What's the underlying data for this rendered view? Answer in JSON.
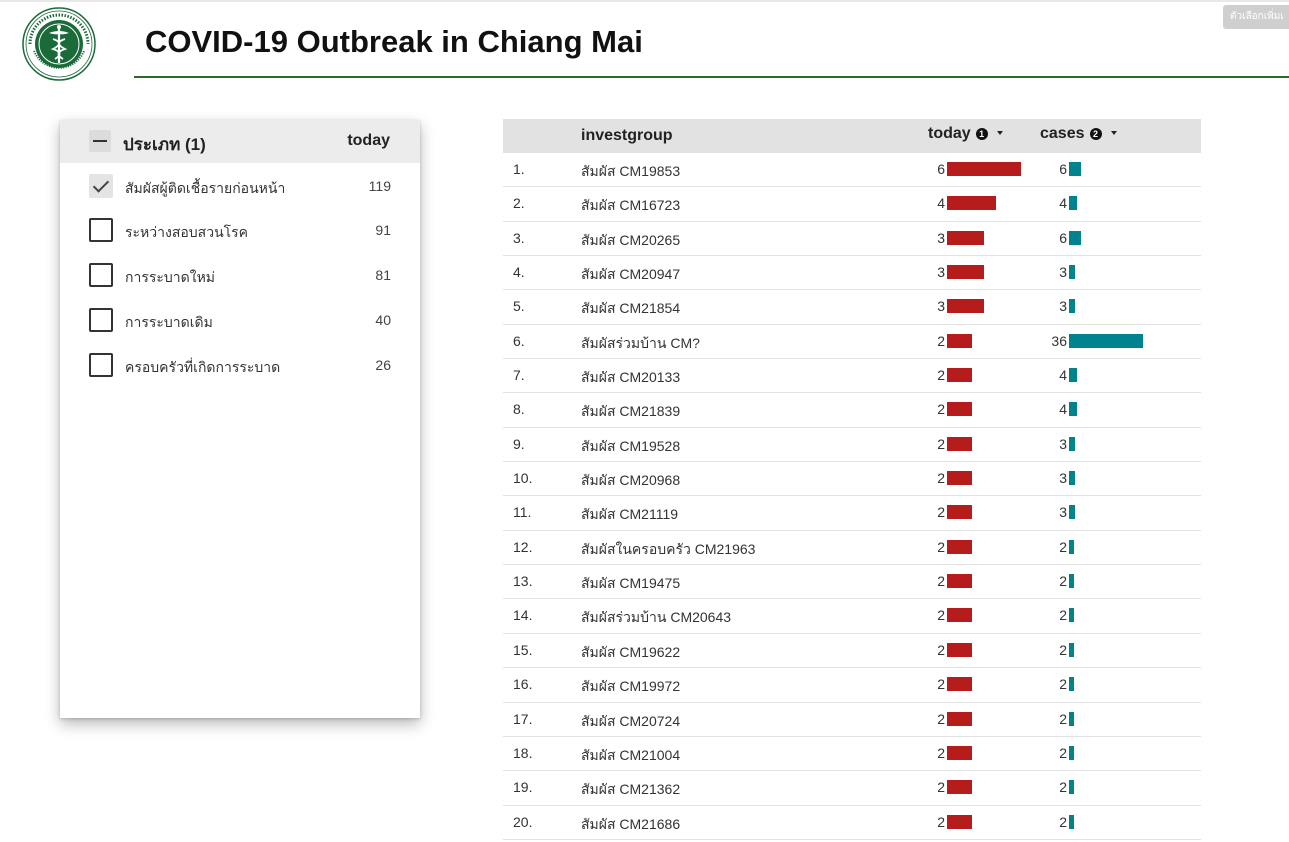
{
  "header": {
    "title": "COVID-19 Outbreak in Chiang Mai",
    "more_selectors_label": "ตัวเลือกเพิ่มเ"
  },
  "logo": {
    "icon": "caduceus-seal-icon",
    "color": "#1b6b3a"
  },
  "filter": {
    "title": "ประเภท (1)",
    "metric_label": "today",
    "items": [
      {
        "label": "สัมผัสผู้ติดเชื้อรายก่อนหน้า",
        "count": "119",
        "checked": true
      },
      {
        "label": "ระหว่างสอบสวนโรค",
        "count": "91",
        "checked": false
      },
      {
        "label": "การระบาดใหม่",
        "count": "81",
        "checked": false
      },
      {
        "label": "การระบาดเดิม",
        "count": "40",
        "checked": false
      },
      {
        "label": "ครอบครัวที่เกิดการระบาด",
        "count": "26",
        "checked": false
      }
    ]
  },
  "table": {
    "columns": {
      "group": "investgroup",
      "today": "today",
      "today_badge": "1",
      "cases": "cases",
      "cases_badge": "2"
    },
    "colors": {
      "today_bar": "#b71c1c",
      "cases_bar": "#00838f"
    },
    "rows": [
      {
        "index": "1.",
        "group": "สัมผัส CM19853",
        "today": 6,
        "cases": 6
      },
      {
        "index": "2.",
        "group": "สัมผัส CM16723",
        "today": 4,
        "cases": 4
      },
      {
        "index": "3.",
        "group": "สัมผัส CM20265",
        "today": 3,
        "cases": 6
      },
      {
        "index": "4.",
        "group": "สัมผัส CM20947",
        "today": 3,
        "cases": 3
      },
      {
        "index": "5.",
        "group": "สัมผัส CM21854",
        "today": 3,
        "cases": 3
      },
      {
        "index": "6.",
        "group": "สัมผัสร่วมบ้าน CM?",
        "today": 2,
        "cases": 36
      },
      {
        "index": "7.",
        "group": "สัมผัส CM20133",
        "today": 2,
        "cases": 4
      },
      {
        "index": "8.",
        "group": "สัมผัส CM21839",
        "today": 2,
        "cases": 4
      },
      {
        "index": "9.",
        "group": "สัมผัส CM19528",
        "today": 2,
        "cases": 3
      },
      {
        "index": "10.",
        "group": "สัมผัส CM20968",
        "today": 2,
        "cases": 3
      },
      {
        "index": "11.",
        "group": "สัมผัส CM21119",
        "today": 2,
        "cases": 3
      },
      {
        "index": "12.",
        "group": "สัมผัสในครอบครัว CM21963",
        "today": 2,
        "cases": 2
      },
      {
        "index": "13.",
        "group": "สัมผัส CM19475",
        "today": 2,
        "cases": 2
      },
      {
        "index": "14.",
        "group": "สัมผัสร่วมบ้าน CM20643",
        "today": 2,
        "cases": 2
      },
      {
        "index": "15.",
        "group": "สัมผัส CM19622",
        "today": 2,
        "cases": 2
      },
      {
        "index": "16.",
        "group": "สัมผัส CM19972",
        "today": 2,
        "cases": 2
      },
      {
        "index": "17.",
        "group": "สัมผัส CM20724",
        "today": 2,
        "cases": 2
      },
      {
        "index": "18.",
        "group": "สัมผัส CM21004",
        "today": 2,
        "cases": 2
      },
      {
        "index": "19.",
        "group": "สัมผัส CM21362",
        "today": 2,
        "cases": 2
      },
      {
        "index": "20.",
        "group": "สัมผัส CM21686",
        "today": 2,
        "cases": 2
      }
    ]
  }
}
